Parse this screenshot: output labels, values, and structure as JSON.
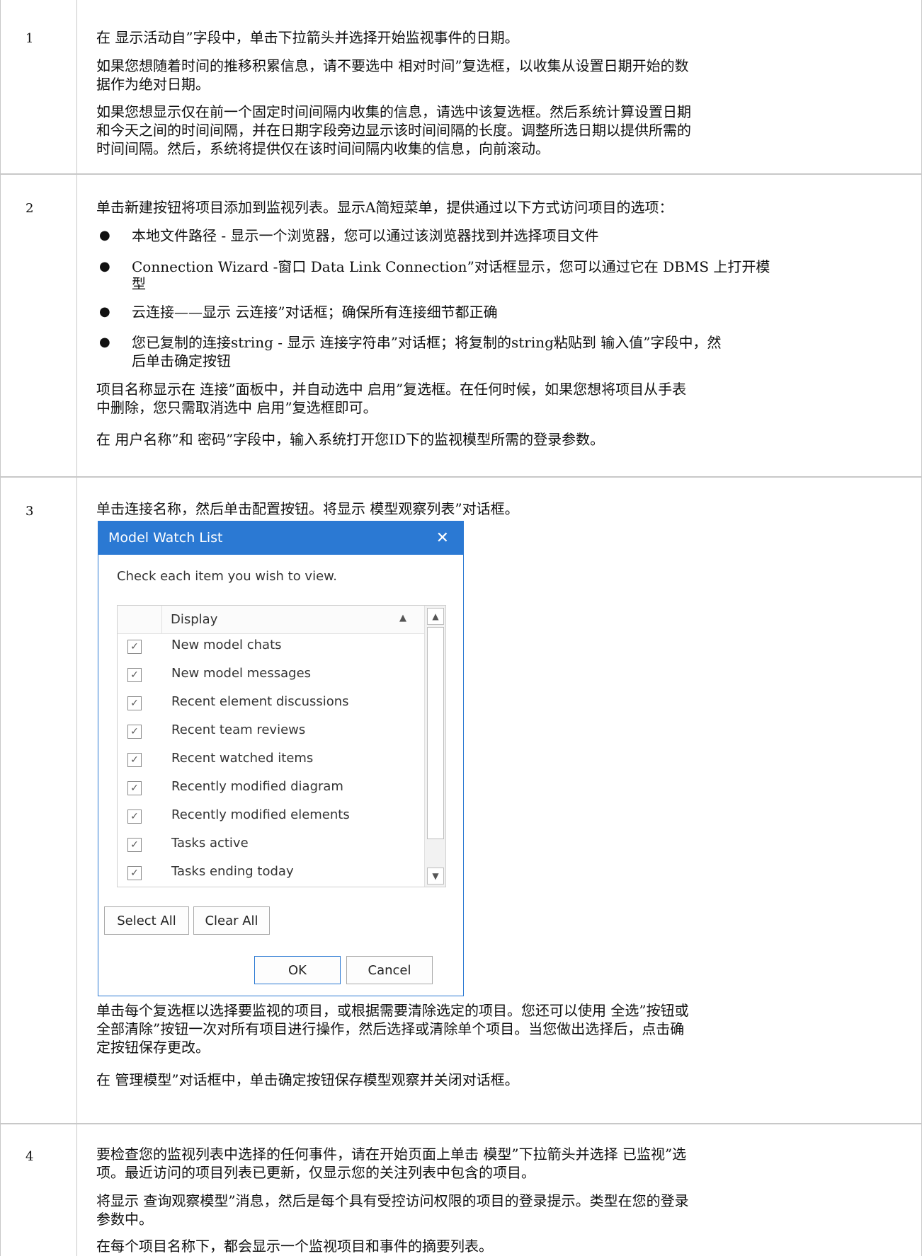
{
  "rows": [
    {
      "number": "1",
      "paragraphs": [
        "在 显示活动自”字段中，单击下拉箭头并选择开始监视事件的日期。",
        "如果您想随着时间的推移积累信息，请不要选中 相对时间”复选框，以收集从设置日期开始的数",
        "据作为绝对日期。",
        "如果您想显示仅在前一个固定时间间隔内收集的信息，请选中该复选框。然后系统计算设置日期",
        "和今天之间的时间间隔，并在日期字段旁边显示该时间间隔的长度。调整所选日期以提供所需的",
        "时间间隔。然后，系统将提供仅在该时间间隔内收集的信息，向前滚动。"
      ]
    },
    {
      "number": "2",
      "intro": "单击新建按钮将项目添加到监视列表。显示A简短菜单，提供通过以下方式访问项目的选项：",
      "bullets": [
        "本地文件路径 - 显示一个浏览器，您可以通过该浏览器找到并选择项目文件",
        "Connection Wizard -窗口 Data Link Connection”对话框显示，您可以通过它在 DBMS 上打开模",
        "型",
        "云连接——显示 云连接”对话框；确保所有连接细节都正确",
        "您已复制的连接string - 显示 连接字符串”对话框；将复制的string粘贴到 输入值”字段中，然",
        "后单击确定按钮"
      ],
      "paragraphs": [
        "项目名称显示在 连接”面板中，并自动选中 启用”复选框。在任何时候，如果您想将项目从手表",
        "中删除，您只需取消选中 启用”复选框即可。",
        "在 用户名称”和 密码”字段中，输入系统打开您ID下的监视模型所需的登录参数。"
      ]
    },
    {
      "number": "3",
      "intro": "单击连接名称，然后单击配置按钮。将显示 模型观察列表”对话框。",
      "paragraphs": [
        "单击每个复选框以选择要监视的项目，或根据需要清除选定的项目。您还可以使用 全选”按钮或",
        " 全部清除”按钮一次对所有项目进行操作，然后选择或清除单个项目。当您做出选择后，点击确",
        "定按钮保存更改。",
        "在 管理模型”对话框中，单击确定按钮保存模型观察并关闭对话框。"
      ]
    },
    {
      "number": "4",
      "paragraphs": [
        "要检查您的监视列表中选择的任何事件，请在开始页面上单击 模型”下拉箭头并选择 已监视”选",
        "项。最近访问的项目列表已更新，仅显示您的关注列表中包含的项目。",
        "将显示 查询观察模型”消息，然后是每个具有受控访问权限的项目的登录提示。类型在您的登录",
        "参数中。",
        "在每个项目名称下，都会显示一个监视项目和事件的摘要列表。"
      ]
    }
  ],
  "dialog": {
    "title": "Model Watch List",
    "close_glyph": "✕",
    "prompt": "Check each item you wish to view.",
    "column_header": "Display",
    "sort_glyph": "▲",
    "checkmark": "✓",
    "items": [
      {
        "label": "New model chats",
        "checked": true
      },
      {
        "label": "New model messages",
        "checked": true
      },
      {
        "label": "Recent element discussions",
        "checked": true
      },
      {
        "label": "Recent team reviews",
        "checked": true
      },
      {
        "label": "Recent watched items",
        "checked": true
      },
      {
        "label": "Recently modified diagram",
        "checked": true
      },
      {
        "label": "Recently modified elements",
        "checked": true
      },
      {
        "label": "Tasks active",
        "checked": true
      },
      {
        "label": "Tasks ending today",
        "checked": true
      }
    ],
    "scroll_up_glyph": "▲",
    "scroll_down_glyph": "▼",
    "select_all_label": "Select All",
    "clear_all_label": "Clear All",
    "ok_label": "OK",
    "cancel_label": "Cancel",
    "accent_color": "#2b79d3"
  }
}
